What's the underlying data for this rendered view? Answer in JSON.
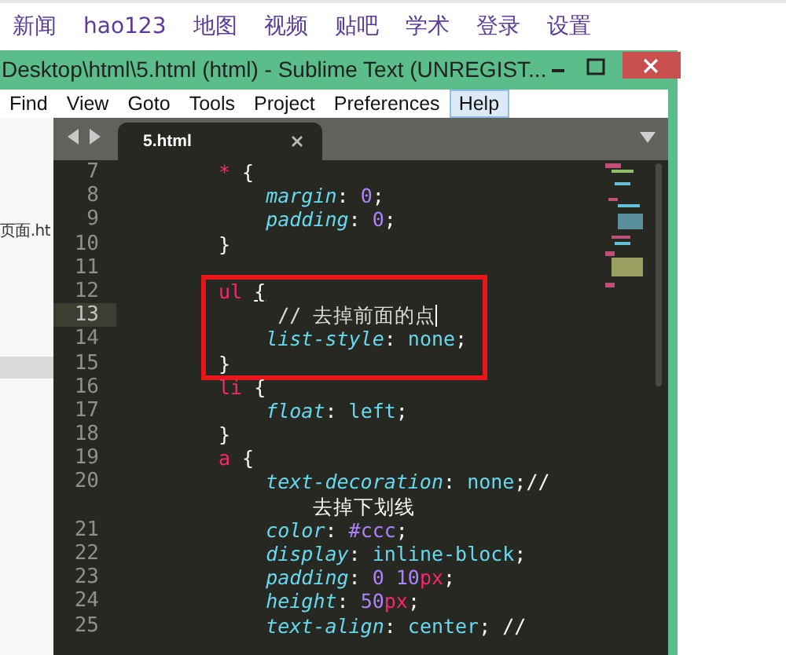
{
  "nav": {
    "links": [
      "新闻",
      "hao123",
      "地图",
      "视频",
      "贴吧",
      "学术",
      "登录",
      "设置"
    ]
  },
  "window": {
    "title": "Desktop\\html\\5.html (html) - Sublime Text (UNREGIST...",
    "menu": [
      {
        "label": "Find",
        "selected": false
      },
      {
        "label": "View",
        "selected": false
      },
      {
        "label": "Goto",
        "selected": false
      },
      {
        "label": "Tools",
        "selected": false
      },
      {
        "label": "Project",
        "selected": false
      },
      {
        "label": "Preferences",
        "selected": false
      },
      {
        "label": "Help",
        "selected": true
      }
    ]
  },
  "sidebar": {
    "items": [
      {
        "label": "页面.ht",
        "selected": false
      },
      {
        "selected": true
      }
    ]
  },
  "tabs": [
    {
      "label": "5.html",
      "selected": true
    }
  ],
  "code": {
    "rows": [
      {
        "kind": "line",
        "number": "7",
        "current": false,
        "tokens": [
          {
            "kind": "selector",
            "text": "*"
          },
          {
            "kind": "punct",
            "text": " {"
          }
        ]
      },
      {
        "kind": "line",
        "number": "8",
        "current": false,
        "tokens": [
          {
            "kind": "property",
            "text": "    margin"
          },
          {
            "kind": "punct",
            "text": ": "
          },
          {
            "kind": "number",
            "text": "0"
          },
          {
            "kind": "punct",
            "text": ";"
          }
        ]
      },
      {
        "kind": "line",
        "number": "9",
        "current": false,
        "tokens": [
          {
            "kind": "property",
            "text": "    padding"
          },
          {
            "kind": "punct",
            "text": ": "
          },
          {
            "kind": "number",
            "text": "0"
          },
          {
            "kind": "punct",
            "text": ";"
          }
        ]
      },
      {
        "kind": "line",
        "number": "10",
        "current": false,
        "tokens": [
          {
            "kind": "punct",
            "text": "}"
          }
        ]
      },
      {
        "kind": "line",
        "number": "11",
        "current": false,
        "tokens": []
      },
      {
        "kind": "box",
        "lines": [
          {
            "kind": "line",
            "number": "12",
            "current": false,
            "tokens": [
              {
                "kind": "selector",
                "text": "ul "
              },
              {
                "kind": "matched",
                "text": "{"
              }
            ]
          },
          {
            "kind": "line",
            "number": "13",
            "current": true,
            "tokens": [
              {
                "kind": "comment",
                "text": "     // 去掉前面的点"
              }
            ]
          },
          {
            "kind": "line",
            "number": "14",
            "current": false,
            "tokens": [
              {
                "kind": "property",
                "text": "    list-style"
              },
              {
                "kind": "punct",
                "text": ": "
              },
              {
                "kind": "value",
                "text": "none"
              },
              {
                "kind": "punct",
                "text": ";"
              }
            ]
          },
          {
            "kind": "line",
            "number": "15",
            "current": false,
            "tokens": [
              {
                "kind": "punct",
                "text": "}"
              }
            ]
          }
        ]
      },
      {
        "kind": "line",
        "number": "16",
        "current": false,
        "tokens": [
          {
            "kind": "selector",
            "text": "li"
          },
          {
            "kind": "punct",
            "text": " {"
          }
        ]
      },
      {
        "kind": "line",
        "number": "17",
        "current": false,
        "tokens": [
          {
            "kind": "property",
            "text": "    float"
          },
          {
            "kind": "punct",
            "text": ": "
          },
          {
            "kind": "value",
            "text": "left"
          },
          {
            "kind": "punct",
            "text": ";"
          }
        ]
      },
      {
        "kind": "line",
        "number": "18",
        "current": false,
        "tokens": [
          {
            "kind": "punct",
            "text": "}"
          }
        ]
      },
      {
        "kind": "line",
        "number": "19",
        "current": false,
        "tokens": [
          {
            "kind": "selector",
            "text": "a"
          },
          {
            "kind": "punct",
            "text": " {"
          }
        ]
      },
      {
        "kind": "line",
        "number": "20",
        "current": false,
        "tokens": [
          {
            "kind": "property",
            "text": "    text-decoration"
          },
          {
            "kind": "punct",
            "text": ": "
          },
          {
            "kind": "value",
            "text": "none"
          },
          {
            "kind": "punct",
            "text": ";//"
          }
        ],
        "continued": [
          {
            "kind": "punct",
            "text": "        去掉下划线"
          }
        ]
      },
      {
        "kind": "line",
        "number": "21",
        "current": false,
        "tokens": [
          {
            "kind": "property",
            "text": "    color"
          },
          {
            "kind": "punct",
            "text": ": "
          },
          {
            "kind": "number",
            "text": "#ccc"
          },
          {
            "kind": "punct",
            "text": ";"
          }
        ]
      },
      {
        "kind": "line",
        "number": "22",
        "current": false,
        "tokens": [
          {
            "kind": "property",
            "text": "    display"
          },
          {
            "kind": "punct",
            "text": ": "
          },
          {
            "kind": "value",
            "text": "inline-block"
          },
          {
            "kind": "punct",
            "text": ";"
          }
        ]
      },
      {
        "kind": "line",
        "number": "23",
        "current": false,
        "tokens": [
          {
            "kind": "property",
            "text": "    padding"
          },
          {
            "kind": "punct",
            "text": ": "
          },
          {
            "kind": "number",
            "text": "0 10"
          },
          {
            "kind": "unit",
            "text": "px"
          },
          {
            "kind": "punct",
            "text": ";"
          }
        ]
      },
      {
        "kind": "line",
        "number": "24",
        "current": false,
        "tokens": [
          {
            "kind": "property",
            "text": "    height"
          },
          {
            "kind": "punct",
            "text": ": "
          },
          {
            "kind": "number",
            "text": "50"
          },
          {
            "kind": "unit",
            "text": "px"
          },
          {
            "kind": "punct",
            "text": ";"
          }
        ]
      },
      {
        "kind": "line",
        "number": "25",
        "current": false,
        "tokens": [
          {
            "kind": "property",
            "text": "    text-align"
          },
          {
            "kind": "punct",
            "text": ": "
          },
          {
            "kind": "value",
            "text": "center"
          },
          {
            "kind": "punct",
            "text": "; //"
          }
        ]
      }
    ]
  }
}
